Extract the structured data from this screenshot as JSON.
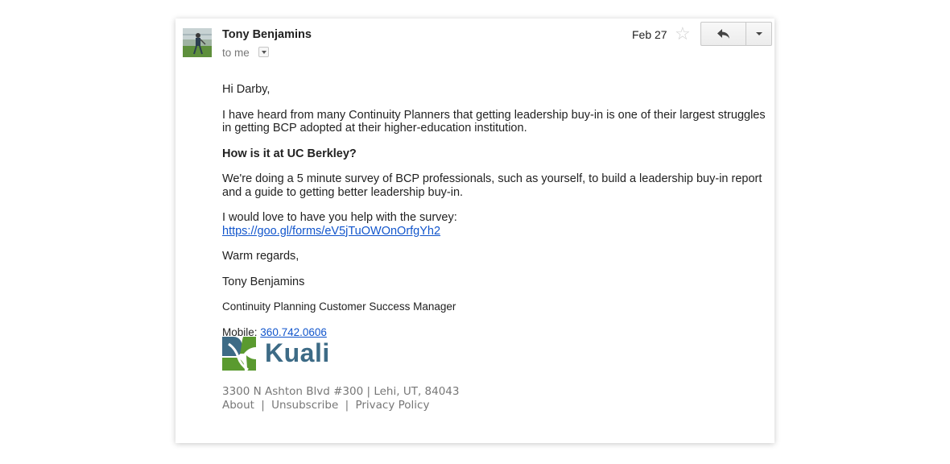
{
  "message": {
    "sender": "Tony Benjamins",
    "recipient_label": "to me",
    "date": "Feb 27"
  },
  "toolbar": {
    "reply_icon": "reply-icon",
    "more_icon": "chevron-down-icon",
    "star_icon": "star-icon"
  },
  "body": {
    "greeting": "Hi Darby,",
    "paragraph1": "I have heard from many Continuity Planners that getting leadership buy-in is one of their largest struggles in getting BCP adopted at their higher-education institution.",
    "question": "How is it at UC Berkley?",
    "paragraph2": "We're doing a 5 minute survey of BCP professionals, such as yourself, to build a leadership buy-in report and a guide to getting better leadership buy-in.",
    "paragraph3": "I would love to have you help with the survey:",
    "survey_link": "https://goo.gl/forms/eV5jTuOWOnOrfgYh2",
    "closing": "Warm regards,",
    "signature_name": "Tony Benjamins",
    "signature_title": "Continuity Planning Customer Success Manager",
    "mobile_label": "Mobile:",
    "mobile_number": "360.742.0606"
  },
  "brand": {
    "logo_text": "Kuali",
    "logo_colors": {
      "green": "#5a9a2f",
      "blue": "#3d6b86"
    }
  },
  "footer": {
    "address": "3300 N Ashton Blvd #300 | Lehi, UT, 84043",
    "links": [
      "About",
      "Unsubscribe",
      "Privacy Policy"
    ],
    "separator": "|"
  },
  "colors": {
    "link": "#1155cc",
    "muted": "#777777",
    "text": "#222222"
  }
}
